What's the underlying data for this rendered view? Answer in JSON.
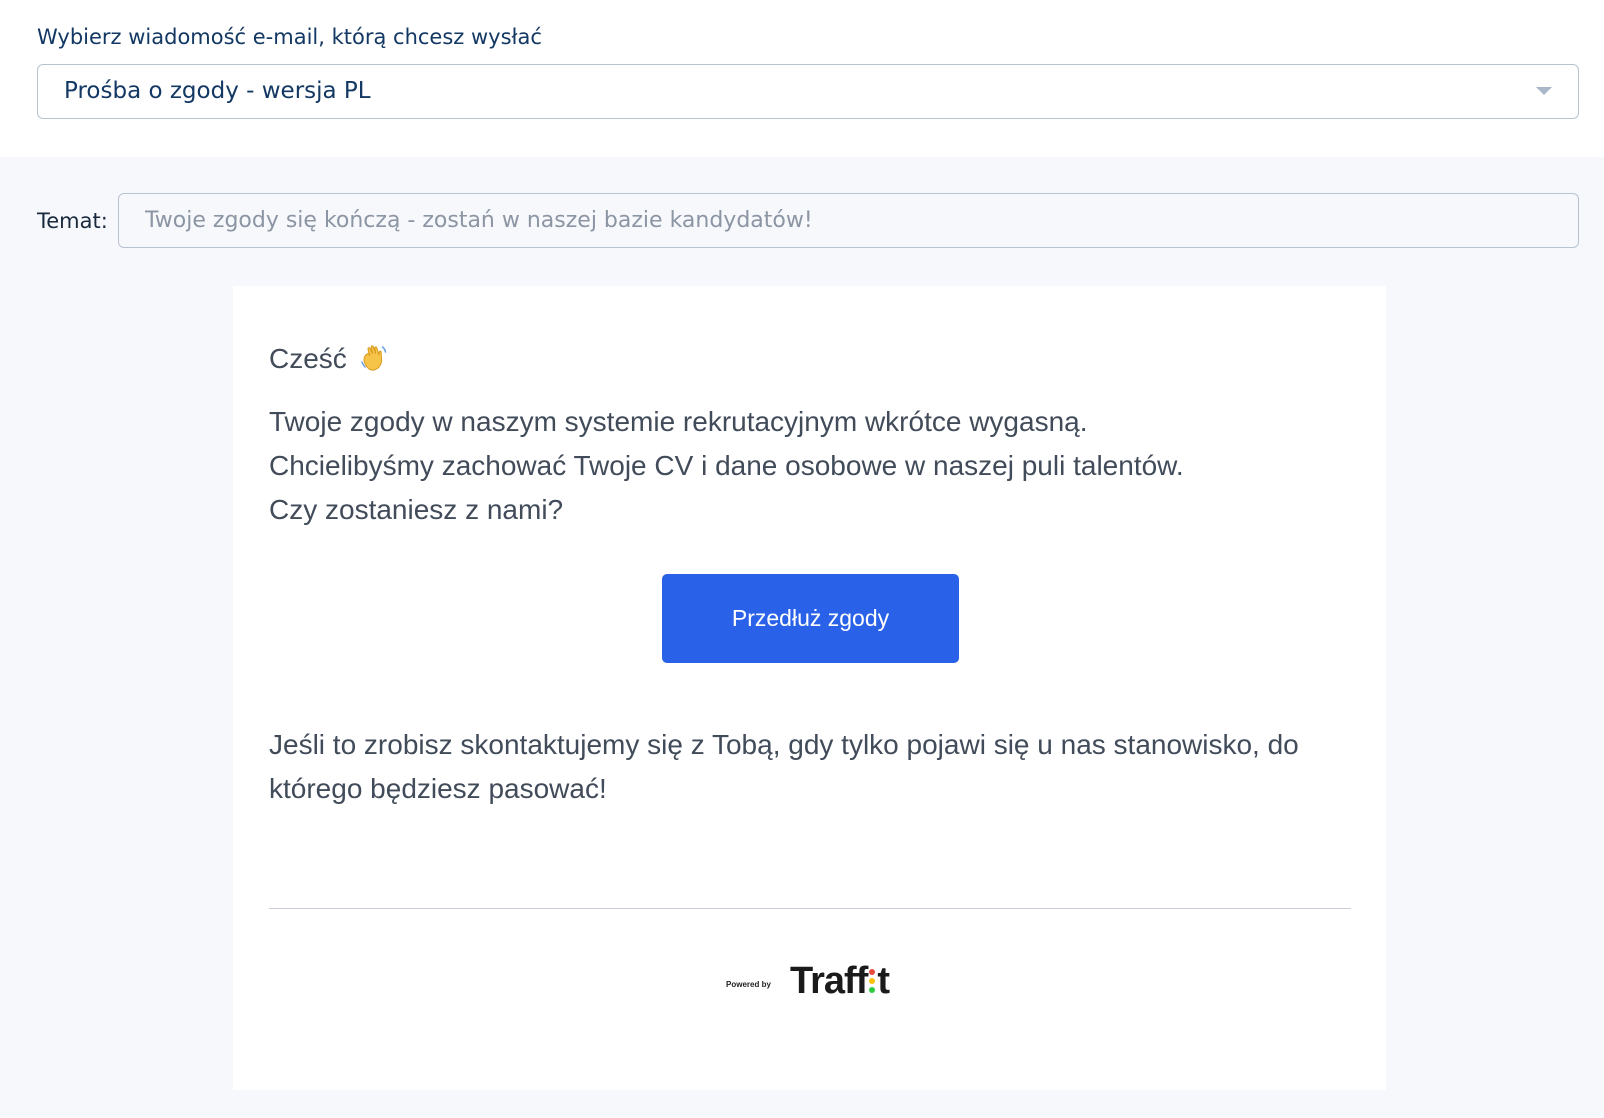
{
  "template_select": {
    "label": "Wybierz wiadomość e-mail, którą chcesz wysłać",
    "selected": "Prośba o zgody - wersja PL"
  },
  "subject": {
    "label": "Temat:",
    "placeholder": "Twoje zgody się kończą - zostań w naszej bazie kandydatów!"
  },
  "email": {
    "greeting": "Cześć",
    "greeting_icon": "waving-hand-icon",
    "body_lines": [
      "Twoje zgody w naszym systemie rekrutacyjnym wkrótce wygasną.",
      "Chcielibyśmy zachować Twoje CV i dane osobowe w naszej puli talentów.",
      "Czy zostaniesz z nami?"
    ],
    "cta_label": "Przedłuż zgody",
    "followup": "Jeśli to zrobisz skontaktujemy się z Tobą, gdy tylko pojawi się u nas stanowisko, do którego będziesz pasować!",
    "footer": {
      "powered_by": "Powered by",
      "brand_start": "Traff",
      "brand_end": "t"
    }
  },
  "colors": {
    "accent": "#2962e8",
    "label_text": "#133863",
    "body_text": "#414b59",
    "page_bg": "#f7f8fc",
    "logo_dots": [
      "#2ecc40",
      "#ffc107",
      "#e74c3c"
    ]
  }
}
